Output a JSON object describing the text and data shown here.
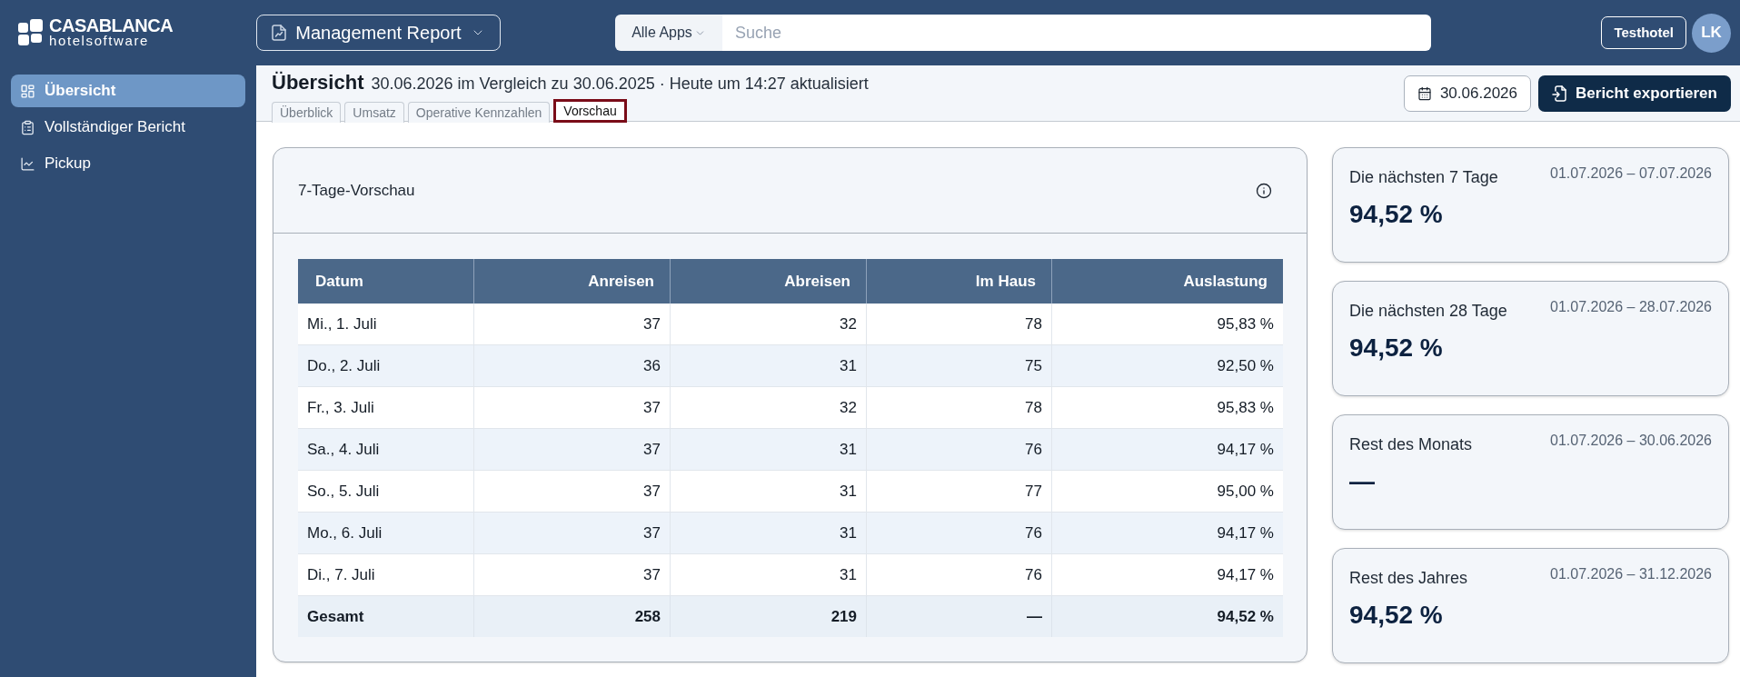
{
  "header": {
    "logo": {
      "wordmark": "CASABLANCA",
      "tagline": "hotelsoftware"
    },
    "report_selector": "Management Report",
    "search": {
      "scope": "Alle Apps",
      "placeholder": "Suche"
    },
    "hotel_button": "Testhotel",
    "avatar": "LK"
  },
  "sidebar": {
    "items": [
      {
        "label": "Übersicht",
        "selected": true
      },
      {
        "label": "Vollständiger Bericht",
        "selected": false
      },
      {
        "label": "Pickup",
        "selected": false
      }
    ]
  },
  "page_header": {
    "title": "Übersicht",
    "subtitle": "30.06.2026 im Vergleich zu 30.06.2025 · Heute um 14:27 aktualisiert",
    "tabs": [
      {
        "label": "Überblick",
        "selected": false
      },
      {
        "label": "Umsatz",
        "selected": false
      },
      {
        "label": "Operative Kennzahlen",
        "selected": false
      },
      {
        "label": "Vorschau",
        "selected": true
      }
    ],
    "date_button": "30.06.2026",
    "export_button": "Bericht exportieren"
  },
  "preview_card": {
    "title": "7-Tage-Vorschau",
    "table": {
      "columns": [
        "Datum",
        "Anreisen",
        "Abreisen",
        "Im Haus",
        "Auslastung"
      ],
      "rows": [
        [
          "Mi., 1. Juli",
          "37",
          "32",
          "78",
          "95,83 %"
        ],
        [
          "Do., 2. Juli",
          "36",
          "31",
          "75",
          "92,50 %"
        ],
        [
          "Fr., 3. Juli",
          "37",
          "32",
          "78",
          "95,83 %"
        ],
        [
          "Sa., 4. Juli",
          "37",
          "31",
          "76",
          "94,17 %"
        ],
        [
          "So., 5. Juli",
          "37",
          "31",
          "77",
          "95,00 %"
        ],
        [
          "Mo., 6. Juli",
          "37",
          "31",
          "76",
          "94,17 %"
        ],
        [
          "Di., 7. Juli",
          "37",
          "31",
          "76",
          "94,17 %"
        ]
      ],
      "total": [
        "Gesamt",
        "258",
        "219",
        "—",
        "94,52 %"
      ]
    }
  },
  "summary_cards": [
    {
      "title": "Die nächsten 7 Tage",
      "range": "01.07.2026 – 07.07.2026",
      "value": "94,52 %"
    },
    {
      "title": "Die nächsten 28 Tage",
      "range": "01.07.2026 – 28.07.2026",
      "value": "94,52 %"
    },
    {
      "title": "Rest des Monats",
      "range": "01.07.2026 – 30.06.2026",
      "value": "—"
    },
    {
      "title": "Rest des Jahres",
      "range": "01.07.2026 – 31.12.2026",
      "value": "94,52 %"
    }
  ]
}
